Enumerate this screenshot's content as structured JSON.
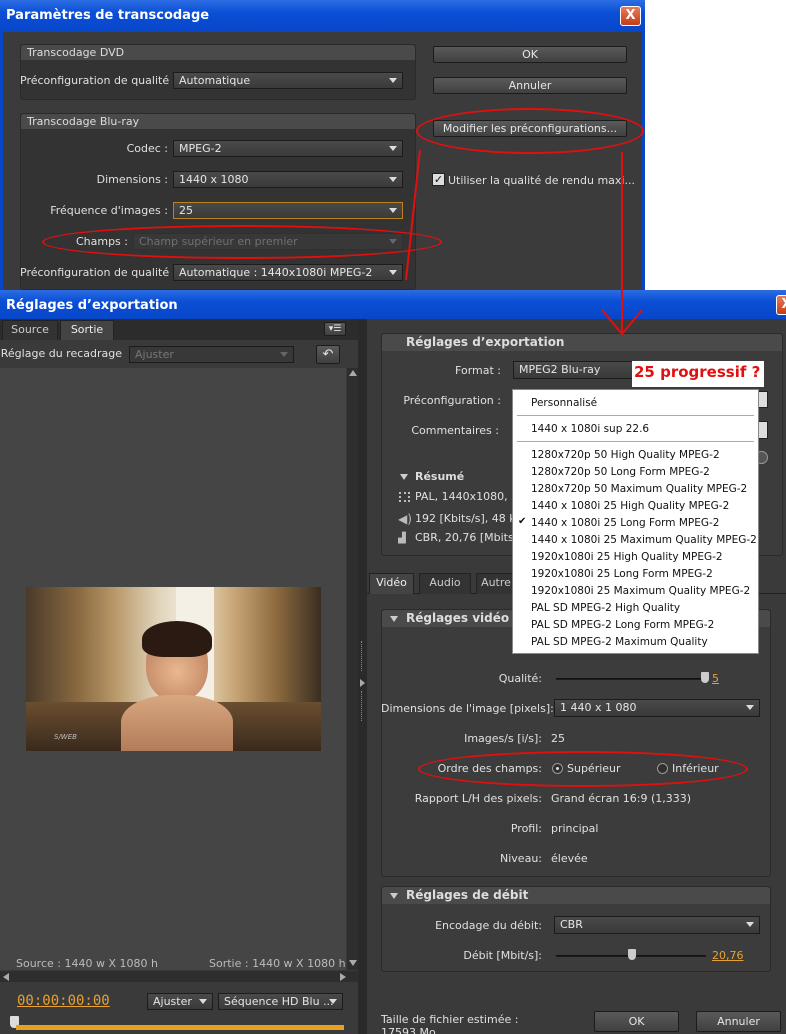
{
  "transcode_dialog": {
    "title": "Paramètres de transcodage",
    "close_label": "X",
    "dvd": {
      "section_label": "Transcodage DVD",
      "quality_preset_label": "Préconfiguration de qualité :",
      "quality_preset_value": "Automatique"
    },
    "bluray": {
      "section_label": "Transcodage Blu-ray",
      "codec_label": "Codec :",
      "codec_value": "MPEG-2",
      "dimensions_label": "Dimensions :",
      "dimensions_value": "1440 x 1080",
      "framerate_label": "Fréquence d'images :",
      "framerate_value": "25",
      "fields_label": "Champs :",
      "fields_value": "Champ supérieur en premier",
      "quality_preset_label": "Préconfiguration de qualité :",
      "quality_preset_value": "Automatique : 1440x1080i MPEG-2"
    },
    "ok_label": "OK",
    "cancel_label": "Annuler",
    "modify_presets_label": "Modifier les préconfigurations...",
    "max_render_quality_label": "Utiliser la qualité de rendu maxi..."
  },
  "export_dialog": {
    "title": "Réglages d’exportation",
    "close_label": "X",
    "left": {
      "tabs": [
        "Source",
        "Sortie"
      ],
      "crop_label": "Réglage du recadrage",
      "crop_value": "Ajuster",
      "video_overlay_text": "S/WEB",
      "source_info": "Source : 1440 w X 1080 h",
      "output_info": "Sortie : 1440 w X 1080 h",
      "timecode": "00:00:00:00",
      "fit_label": "Ajuster",
      "sequence_label": "Séquence HD Blu ..."
    },
    "right": {
      "export_settings_header": "Réglages d’exportation",
      "format_label": "Format :",
      "format_value": "MPEG2 Blu-ray",
      "preset_label": "Préconfiguration :",
      "comments_label": "Commentaires :",
      "summary_label": "Résumé",
      "summary_lines": [
        "PAL, 1440x1080, 25",
        "192 [Kbits/s], 48 kH",
        "CBR, 20,76 [Mbits/s"
      ],
      "tabs": [
        "Vidéo",
        "Audio",
        "Autre"
      ],
      "video_settings_header": "Réglages vidéo de",
      "quality_label": "Qualité:",
      "quality_value": "5",
      "frame_size_label": "Dimensions de l'image [pixels]:",
      "frame_size_value": "1 440 x 1 080",
      "fps_label": "Images/s [i/s]:",
      "fps_value": "25",
      "field_order_label": "Ordre des champs:",
      "field_upper": "Supérieur",
      "field_lower": "Inférieur",
      "par_label": "Rapport L/H des pixels:",
      "par_value": "Grand écran 16:9 (1,333)",
      "profile_label": "Profil:",
      "profile_value": "principal",
      "level_label": "Niveau:",
      "level_value": "élevée",
      "bitrate_header": "Réglages de débit",
      "bitrate_encoding_label": "Encodage du débit:",
      "bitrate_encoding_value": "CBR",
      "bitrate_label": "Débit [Mbit/s]:",
      "bitrate_value": "20,76",
      "filesize_label": "Taille de fichier estimée :",
      "filesize_value": "17593 Mo",
      "ok_label": "OK",
      "cancel_label": "Annuler"
    },
    "preset_menu": {
      "items": [
        "Personnalisé",
        "1440 x 1080i sup 22.6",
        "1280x720p 50 High Quality MPEG-2",
        "1280x720p 50 Long Form MPEG-2",
        "1280x720p 50 Maximum Quality MPEG-2",
        "1440 x 1080i 25 High Quality MPEG-2",
        "1440 x 1080i 25 Long Form MPEG-2",
        "1440 x 1080i 25 Maximum Quality MPEG-2",
        "1920x1080i 25 High Quality MPEG-2",
        "1920x1080i 25 Long Form MPEG-2",
        "1920x1080i 25 Maximum Quality MPEG-2",
        "PAL SD MPEG-2 High Quality",
        "PAL SD MPEG-2 Long Form MPEG-2",
        "PAL SD MPEG-2 Maximum Quality"
      ],
      "checked_index": 6
    }
  },
  "annotation": {
    "text": "25 progressif ?",
    "color": "#e01010"
  }
}
